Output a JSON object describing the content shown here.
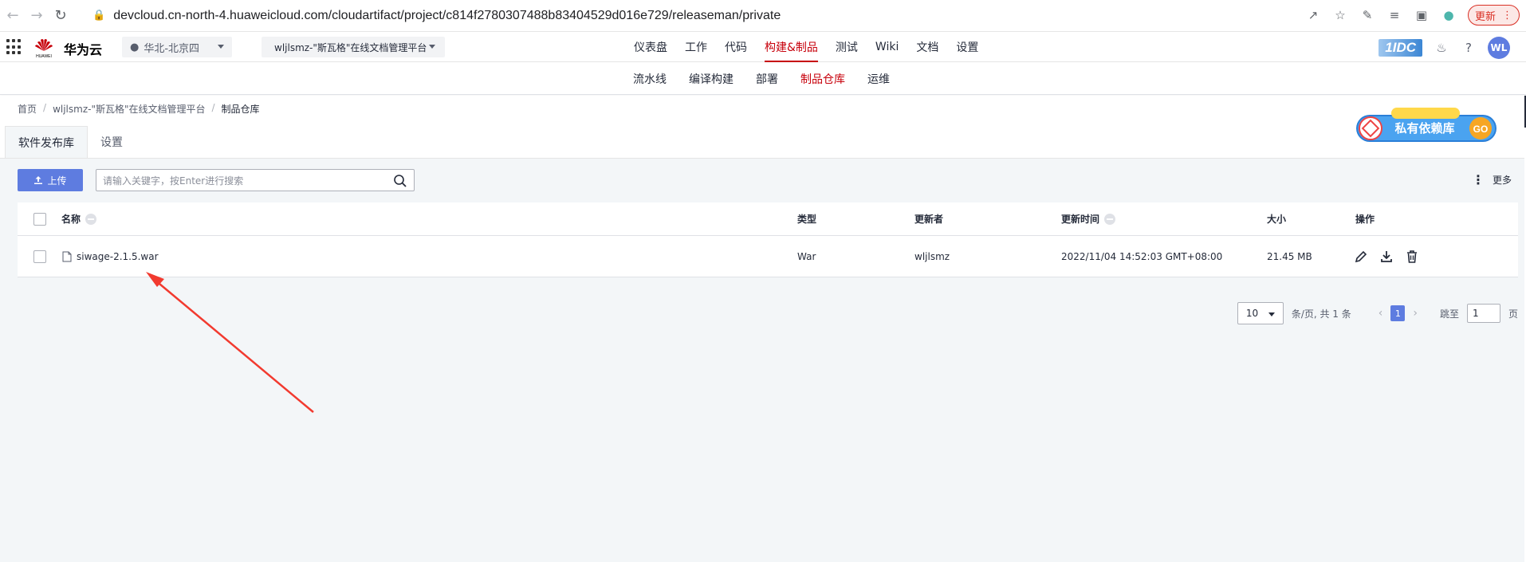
{
  "browser": {
    "url": "devcloud.cn-north-4.huaweicloud.com/cloudartifact/project/c814f2780307488b83404529d016e729/releaseman/private",
    "update_label": "更新"
  },
  "header": {
    "logo_text": "华为云",
    "logo_subtext": "HUAWEI",
    "region": "华北-北京四",
    "project": "wljlsmz-\"斯瓦格\"在线文档管理平台",
    "nav": [
      "仪表盘",
      "工作",
      "代码",
      "构建&制品",
      "测试",
      "Wiki",
      "文档",
      "设置"
    ],
    "nav_active": "构建&制品",
    "idc_label": "1IDC",
    "avatar": "WL"
  },
  "subnav": {
    "items": [
      "流水线",
      "编译构建",
      "部署",
      "制品仓库",
      "运维"
    ],
    "active": "制品仓库"
  },
  "breadcrumb": [
    "首页",
    "wljlsmz-\"斯瓦格\"在线文档管理平台",
    "制品仓库"
  ],
  "tabs": [
    "软件发布库",
    "设置"
  ],
  "banner": {
    "text": "私有依赖库",
    "go": "GO"
  },
  "toolbar": {
    "upload_label": "上传",
    "search_placeholder": "请输入关键字，按Enter进行搜索",
    "more_label": "更多"
  },
  "table": {
    "columns": [
      "名称",
      "类型",
      "更新者",
      "更新时间",
      "大小",
      "操作"
    ],
    "rows": [
      {
        "name": "siwage-2.1.5.war",
        "type": "War",
        "updater": "wljlsmz",
        "updated_at": "2022/11/04 14:52:03 GMT+08:00",
        "size": "21.45 MB"
      }
    ]
  },
  "pagination": {
    "page_size": "10",
    "summary": "条/页, 共 1 条",
    "current_page": "1",
    "jump_label": "跳至",
    "jump_value": "1",
    "page_unit": "页"
  },
  "colors": {
    "brand_red": "#c7000b",
    "primary_blue": "#5e7ce0",
    "annotation_arrow": "#f23a2f"
  }
}
